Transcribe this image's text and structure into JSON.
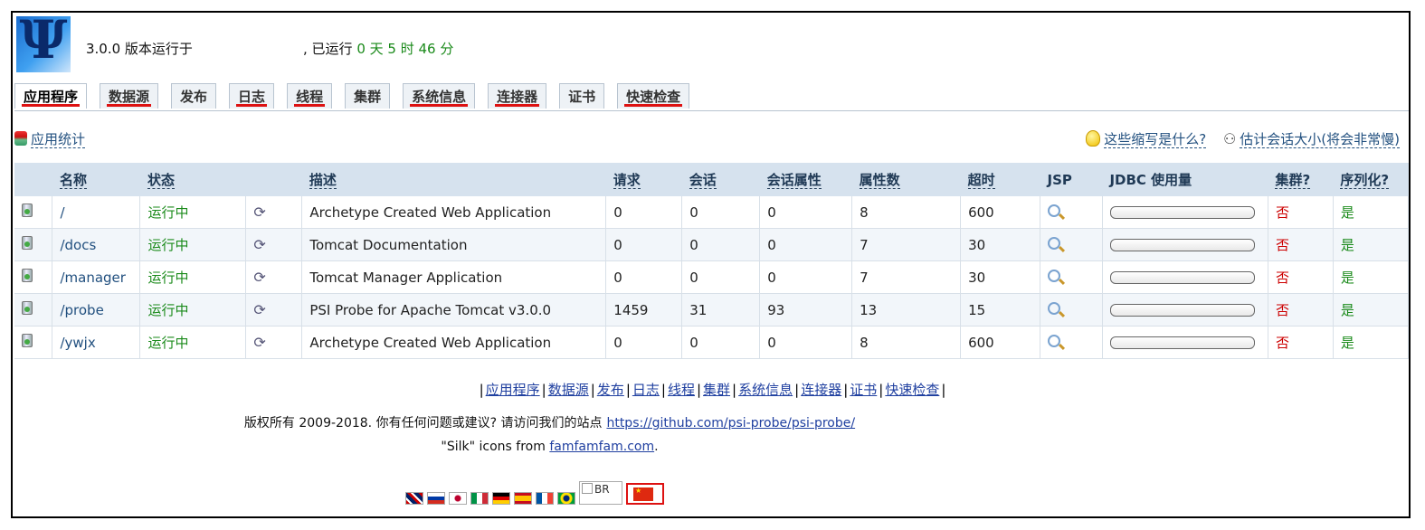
{
  "header": {
    "logo_symbol": "Ψ",
    "version_text": "3.0.0 版本运行于",
    "uptime_prefix": ", 已运行",
    "uptime_text": " 0 天 5 时 46 分"
  },
  "tabs": [
    {
      "label": "应用程序",
      "active": true,
      "underline": true
    },
    {
      "label": "数据源",
      "active": false,
      "underline": true
    },
    {
      "label": "发布",
      "active": false,
      "underline": false
    },
    {
      "label": "日志",
      "active": false,
      "underline": true
    },
    {
      "label": "线程",
      "active": false,
      "underline": true
    },
    {
      "label": "集群",
      "active": false,
      "underline": false
    },
    {
      "label": "系统信息",
      "active": false,
      "underline": true
    },
    {
      "label": "连接器",
      "active": false,
      "underline": true
    },
    {
      "label": "证书",
      "active": false,
      "underline": false
    },
    {
      "label": "快速检查",
      "active": false,
      "underline": true
    }
  ],
  "toolbar": {
    "app_stats_label": "应用统计",
    "abbrev_help_label": "这些缩写是什么?",
    "session_size_label": "估计会话大小(将会非常慢)"
  },
  "table": {
    "headers": {
      "name": "名称",
      "status": "状态",
      "description": "描述",
      "requests": "请求",
      "sessions": "会话",
      "session_attrs": "会话属性",
      "attr_count": "属性数",
      "timeout": "超时",
      "jsp": "JSP",
      "jdbc": "JDBC 使用量",
      "cluster": "集群?",
      "serializable": "序列化?"
    },
    "rows": [
      {
        "name": "/",
        "status": "运行中",
        "description": "Archetype Created Web Application",
        "requests": "0",
        "sessions": "0",
        "session_attrs": "0",
        "attr_count": "8",
        "timeout": "600",
        "cluster": "否",
        "serializable": "是"
      },
      {
        "name": "/docs",
        "status": "运行中",
        "description": "Tomcat Documentation",
        "requests": "0",
        "sessions": "0",
        "session_attrs": "0",
        "attr_count": "7",
        "timeout": "30",
        "cluster": "否",
        "serializable": "是"
      },
      {
        "name": "/manager",
        "status": "运行中",
        "description": "Tomcat Manager Application",
        "requests": "0",
        "sessions": "0",
        "session_attrs": "0",
        "attr_count": "7",
        "timeout": "30",
        "cluster": "否",
        "serializable": "是"
      },
      {
        "name": "/probe",
        "status": "运行中",
        "description": "PSI Probe for Apache Tomcat v3.0.0",
        "requests": "1459",
        "sessions": "31",
        "session_attrs": "93",
        "attr_count": "13",
        "timeout": "15",
        "cluster": "否",
        "serializable": "是"
      },
      {
        "name": "/ywjx",
        "status": "运行中",
        "description": "Archetype Created Web Application",
        "requests": "0",
        "sessions": "0",
        "session_attrs": "0",
        "attr_count": "8",
        "timeout": "600",
        "cluster": "否",
        "serializable": "是"
      }
    ]
  },
  "footer": {
    "nav": [
      "应用程序",
      "数据源",
      "发布",
      "日志",
      "线程",
      "集群",
      "系统信息",
      "连接器",
      "证书",
      "快速检查"
    ],
    "copyright_text": "版权所有 2009-2018. 你有任何问题或建议? 请访问我们的站点",
    "site_link": "https://github.com/psi-probe/psi-probe/",
    "silk_text": "\"Silk\" icons from",
    "silk_link": "famfamfam.com",
    "silk_end": ".",
    "broken_image_alt": "BR"
  },
  "colors": {
    "accent_red": "#dd1111",
    "running_green": "#1a8a1a",
    "header_bg": "#d6e2ee"
  }
}
